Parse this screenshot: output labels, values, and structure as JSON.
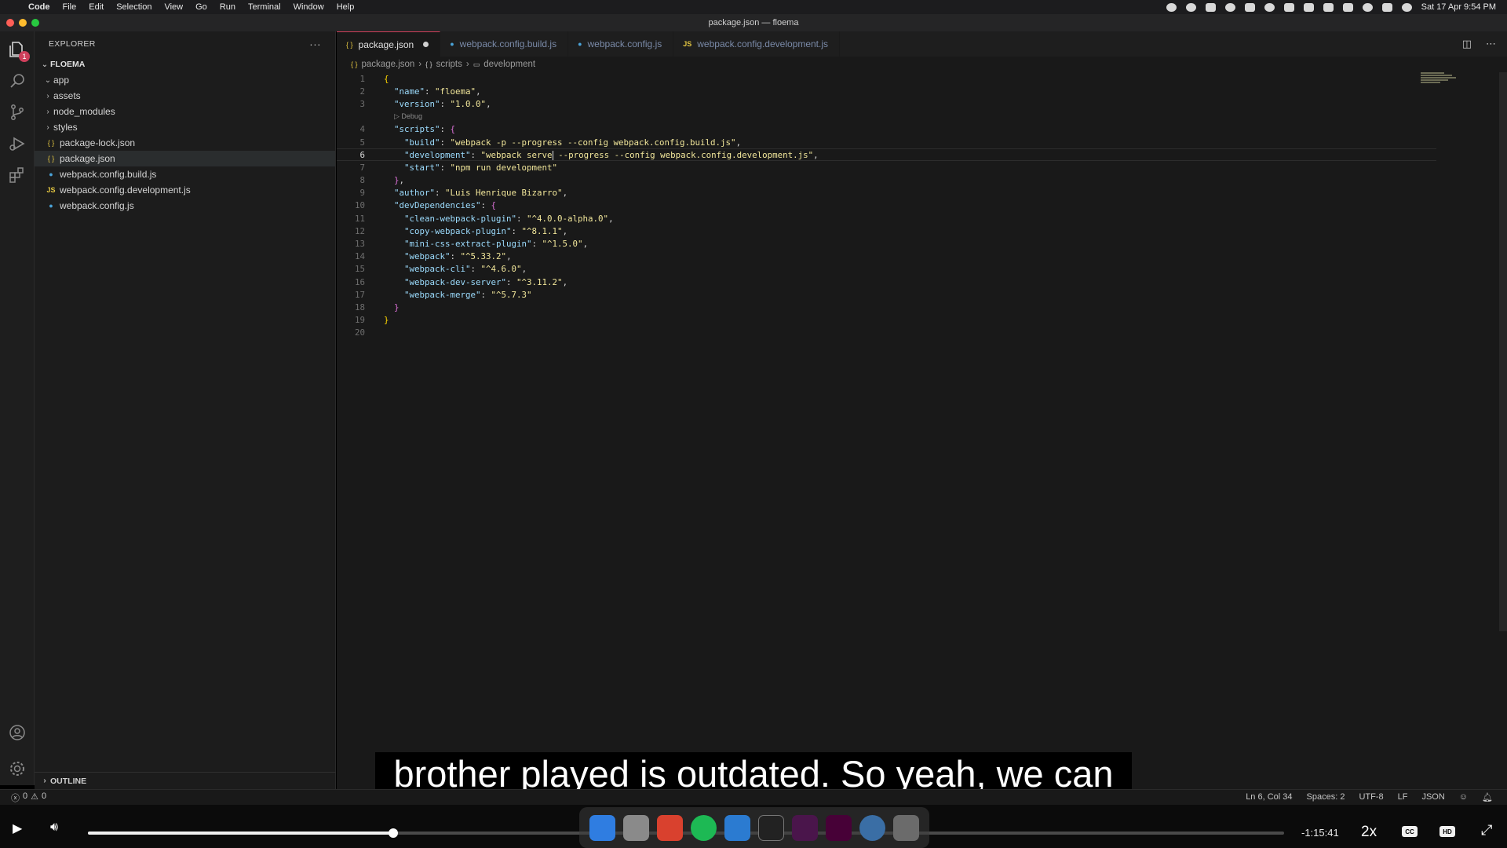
{
  "menubar": {
    "app": "Code",
    "items": [
      "File",
      "Edit",
      "Selection",
      "View",
      "Go",
      "Run",
      "Terminal",
      "Window",
      "Help"
    ],
    "clock": "Sat 17 Apr  9:54 PM"
  },
  "window": {
    "title": "package.json — floema"
  },
  "activity": {
    "explorer_badge": "1"
  },
  "sidebar": {
    "header": "EXPLORER",
    "more": "···",
    "folder": "FLOEMA",
    "items": [
      {
        "label": "app"
      },
      {
        "label": "assets"
      },
      {
        "label": "node_modules"
      },
      {
        "label": "styles"
      },
      {
        "label": "package-lock.json",
        "icon": "{ }"
      },
      {
        "label": "package.json",
        "icon": "{ }"
      },
      {
        "label": "webpack.config.build.js"
      },
      {
        "label": "webpack.config.development.js",
        "icon": "JS"
      },
      {
        "label": "webpack.config.js"
      }
    ],
    "outline": "OUTLINE"
  },
  "tabs": [
    {
      "label": "package.json",
      "icon": "{ }"
    },
    {
      "label": "webpack.config.build.js"
    },
    {
      "label": "webpack.config.js"
    },
    {
      "label": "webpack.config.development.js",
      "icon": "JS"
    }
  ],
  "breadcrumb": [
    "package.json",
    "scripts",
    "development"
  ],
  "breadcrumb_icons": [
    "{ }",
    "{ }"
  ],
  "codelens": "▷ Debug",
  "code": {
    "lines": [
      "{",
      "  \"name\": \"floema\",",
      "  \"version\": \"1.0.0\",",
      "  \"scripts\": {",
      "    \"build\": \"webpack -p --progress --config webpack.config.build.js\",",
      "    \"development\": \"webpack serve --progress --config webpack.config.development.js\",",
      "    \"start\": \"npm run development\"",
      "  },",
      "  \"author\": \"Luis Henrique Bizarro\",",
      "  \"devDependencies\": {",
      "    \"clean-webpack-plugin\": \"^4.0.0-alpha.0\",",
      "    \"copy-webpack-plugin\": \"^8.1.1\",",
      "    \"mini-css-extract-plugin\": \"^1.5.0\",",
      "    \"webpack\": \"^5.33.2\",",
      "    \"webpack-cli\": \"^4.6.0\",",
      "    \"webpack-dev-server\": \"^3.11.2\",",
      "    \"webpack-merge\": \"^5.7.3\"",
      "  }",
      "}",
      ""
    ]
  },
  "status": {
    "errors": "0",
    "warnings": "0",
    "position": "Ln 6, Col 34",
    "spaces": "Spaces: 2",
    "encoding": "UTF-8",
    "eol": "LF",
    "language": "JSON"
  },
  "subtitle": "brother played is outdated. So yeah, we can",
  "player": {
    "time": "-1:15:41",
    "speed": "2x",
    "progress": 0.255,
    "cc": "CC",
    "hd": "HD"
  }
}
